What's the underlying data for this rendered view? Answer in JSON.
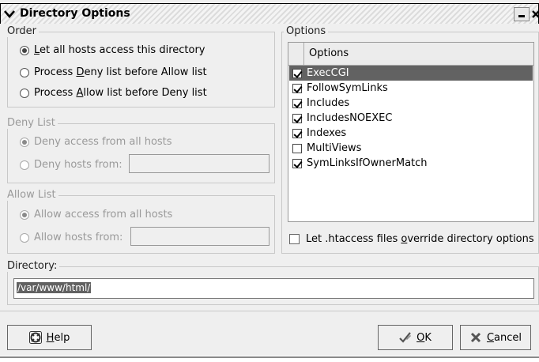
{
  "window": {
    "title": "Directory Options"
  },
  "order": {
    "label": "Order",
    "options": [
      {
        "pre": "",
        "key": "L",
        "post": "et all hosts access this directory",
        "selected": true
      },
      {
        "pre": "Process ",
        "key": "D",
        "post": "eny list before Allow list",
        "selected": false
      },
      {
        "pre": "Process ",
        "key": "A",
        "post": "llow list before Deny list",
        "selected": false
      }
    ]
  },
  "deny_list": {
    "label": "Deny List",
    "option_all": "Deny access from all hosts",
    "option_from": "Deny hosts from:",
    "hosts_value": ""
  },
  "allow_list": {
    "label": "Allow List",
    "option_all": "Allow access from all hosts",
    "option_from": "Allow hosts from:",
    "hosts_value": ""
  },
  "options": {
    "label": "Options",
    "column_header": "Options",
    "items": [
      {
        "name": "ExecCGI",
        "checked": true,
        "selected": true
      },
      {
        "name": "FollowSymLinks",
        "checked": true,
        "selected": false
      },
      {
        "name": "Includes",
        "checked": true,
        "selected": false
      },
      {
        "name": "IncludesNOEXEC",
        "checked": true,
        "selected": false
      },
      {
        "name": "Indexes",
        "checked": true,
        "selected": false
      },
      {
        "name": "MultiViews",
        "checked": false,
        "selected": false
      },
      {
        "name": "SymLinksIfOwnerMatch",
        "checked": true,
        "selected": false
      }
    ],
    "override": {
      "pre": "Let .htaccess files ",
      "key": "o",
      "post": "verride directory options",
      "checked": false
    }
  },
  "directory": {
    "label": "Directory:",
    "value": "/var/www/html/"
  },
  "buttons": {
    "help": {
      "key": "H",
      "rest": "elp"
    },
    "ok": {
      "key": "O",
      "rest": "K"
    },
    "cancel": {
      "key": "C",
      "rest": "ancel"
    }
  },
  "icons": {
    "menu": "chevron-down-icon",
    "minimize": "minimize-icon",
    "close": "close-icon",
    "help": "help-icon",
    "ok": "checkmark-pen-icon",
    "cancel": "x-mark-icon"
  }
}
